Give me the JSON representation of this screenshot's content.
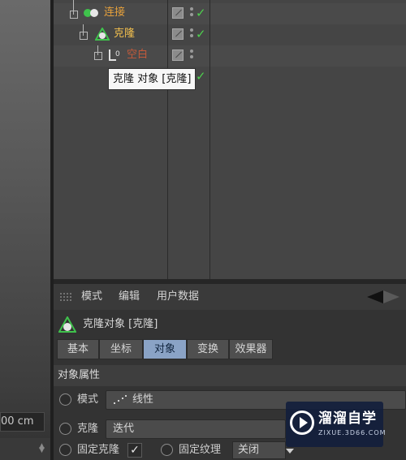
{
  "viewport": {
    "measure_value": "00 cm"
  },
  "object_tree": {
    "rows": [
      {
        "label": "连接",
        "icon": "connect-icon",
        "visible_check": true
      },
      {
        "label": "克隆",
        "icon": "cloner-icon",
        "visible_check": true
      },
      {
        "label": "空白",
        "icon": "null-object-icon",
        "visible_check": false
      },
      {
        "label": "",
        "icon": "",
        "visible_check": true
      }
    ],
    "tooltip": "克隆 对象 [克隆]"
  },
  "attribute_manager": {
    "menu": [
      "模式",
      "编辑",
      "用户数据"
    ],
    "object_title": "克隆对象 [克隆]",
    "tabs": [
      {
        "label": "基本",
        "active": false
      },
      {
        "label": "坐标",
        "active": false
      },
      {
        "label": "对象",
        "active": true
      },
      {
        "label": "变换",
        "active": false
      },
      {
        "label": "效果器",
        "active": false
      }
    ],
    "section": "对象属性",
    "props": {
      "mode_label": "模式",
      "mode_value": "线性",
      "clone_label": "克隆",
      "clone_value": "迭代",
      "fix_clone_label": "固定克隆",
      "fix_clone_checked": true,
      "fix_texture_label": "固定纹理",
      "fix_texture_value": "关闭"
    }
  },
  "watermark": {
    "title": "溜溜自学",
    "subtitle": "ZIXUE.3D66.COM"
  },
  "colors": {
    "active_tab": "#8aa3c6",
    "object_label": "#e7a13c",
    "check_green": "#4ed04e"
  }
}
